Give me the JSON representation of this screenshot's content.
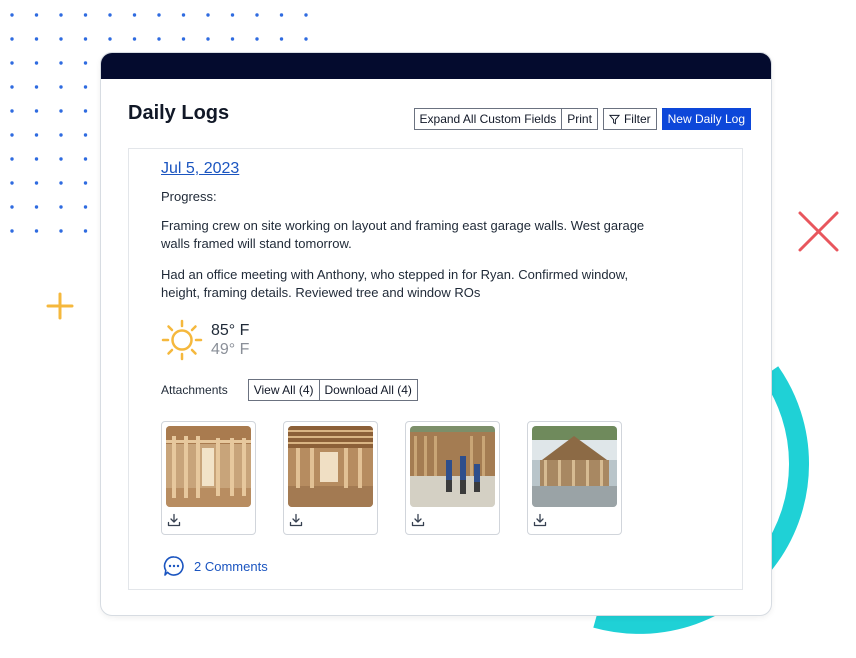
{
  "header": {
    "title": "Daily Logs"
  },
  "toolbar": {
    "expand_label": "Expand All Custom Fields",
    "print_label": "Print",
    "filter_label": "Filter",
    "filter_icon": "filter-icon",
    "new_log_label": "New Daily Log"
  },
  "log": {
    "date": "Jul 5, 2023",
    "progress_label": "Progress:",
    "paragraphs": [
      "Framing crew on site working on layout and framing east garage walls. West garage walls framed will stand tomorrow.",
      "Had an office meeting with Anthony, who stepped in for Ryan. Confirmed window, height, framing details. Reviewed tree and window ROs"
    ],
    "weather": {
      "icon": "sun-icon",
      "high": "85° F",
      "low": "49° F"
    },
    "attachments": {
      "label": "Attachments",
      "view_all_label": "View All (4)",
      "download_all_label": "Download All (4)",
      "items": [
        {
          "image": "framing-interior-photo",
          "download_icon": "download-icon"
        },
        {
          "image": "framing-room-photo",
          "download_icon": "download-icon"
        },
        {
          "image": "crew-framing-photo",
          "download_icon": "download-icon"
        },
        {
          "image": "garage-frame-photo",
          "download_icon": "download-icon"
        }
      ]
    },
    "comments": {
      "icon": "comment-icon",
      "label": "2 Comments"
    }
  },
  "colors": {
    "topbar": "#040b2e",
    "primary": "#0d47d9",
    "link": "#1b55c0",
    "sun": "#f5b83d",
    "cross": "#e8565d",
    "plus": "#f5b83d",
    "ring": "#1fd1d6",
    "dots": "#2f6be0"
  }
}
